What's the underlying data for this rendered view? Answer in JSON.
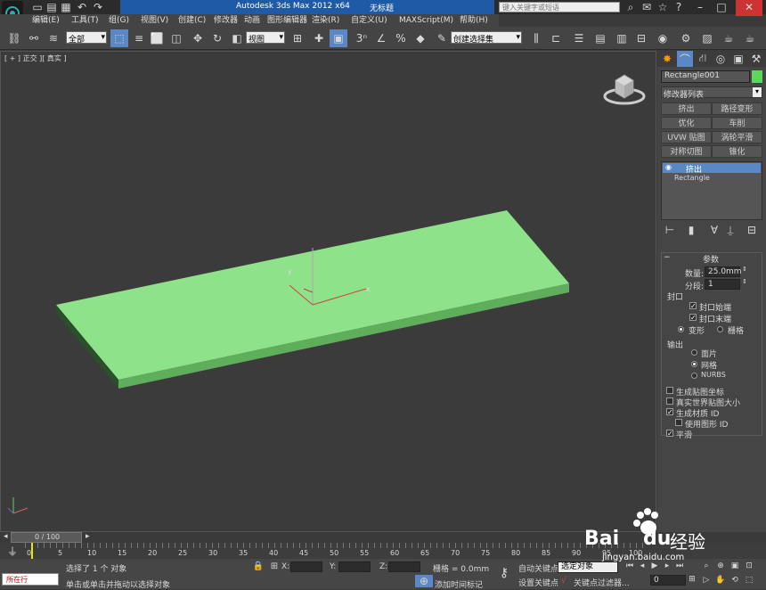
{
  "window": {
    "title": "Autodesk 3ds Max  2012 x64",
    "doc_title": "无标题",
    "search_placeholder": "键入关键字或短语"
  },
  "menu": [
    "编辑(E)",
    "工具(T)",
    "组(G)",
    "视图(V)",
    "创建(C)",
    "修改器",
    "动画",
    "图形编辑器",
    "渲染(R)",
    "自定义(U)",
    "MAXScript(M)",
    "帮助(H)"
  ],
  "toolbar": {
    "selection_filter": "全部",
    "ref_coord": "视图",
    "named_selection": "创建选择集"
  },
  "viewport": {
    "label": "[ + ] 正交 ][ 真实 ]"
  },
  "command_panel": {
    "object_name": "Rectangle001",
    "object_color": "#5cd65c",
    "modifier_list": "修改器列表",
    "modifier_buttons": [
      "挤出",
      "路径变形",
      "优化",
      "车削",
      "UVW 贴图",
      "涡轮平滑",
      "对称切图",
      "锥化"
    ],
    "stack": [
      "挤出",
      "Rectangle"
    ],
    "params_title": "参数",
    "amount_label": "数量:",
    "amount_value": "25.0mm",
    "segments_label": "分段:",
    "segments_value": "1",
    "cap_title": "封口",
    "cap_start": "封口始端",
    "cap_end": "封口末端",
    "morph": "变形",
    "grid": "栅格",
    "output_title": "输出",
    "patch": "面片",
    "mesh": "网格",
    "nurbs": "NURBS",
    "gen_map_coords": "生成贴图坐标",
    "real_world": "真实世界贴图大小",
    "gen_mat_ids": "生成材质 ID",
    "use_shape_ids": "使用图形 ID",
    "smooth": "平滑"
  },
  "timeline": {
    "frame": "0 / 100",
    "ticks": [
      "0",
      "5",
      "10",
      "15",
      "20",
      "25",
      "30",
      "35",
      "40",
      "45",
      "50",
      "55",
      "60",
      "65",
      "70",
      "75",
      "80",
      "85",
      "90",
      "95",
      "100"
    ]
  },
  "status": {
    "mode": "所在行",
    "selected": "选择了 1 个 对象",
    "prompt": "单击或单击并拖动以选择对象",
    "x_label": "X:",
    "y_label": "Y:",
    "z_label": "Z:",
    "grid": "栅格 = 0.0mm",
    "add_time_tag": "添加时间标记",
    "auto_key": "自动关键点",
    "set_key": "设置关键点",
    "selected_obj": "选定对象",
    "key_filters": "关键点过滤器...",
    "frame_field": "0"
  },
  "watermark": {
    "brand": "Bai",
    "brand2": "du",
    "brand3": "经验",
    "url": "jingyan.baidu.com"
  },
  "axis": {
    "x": "x",
    "y": "y"
  }
}
